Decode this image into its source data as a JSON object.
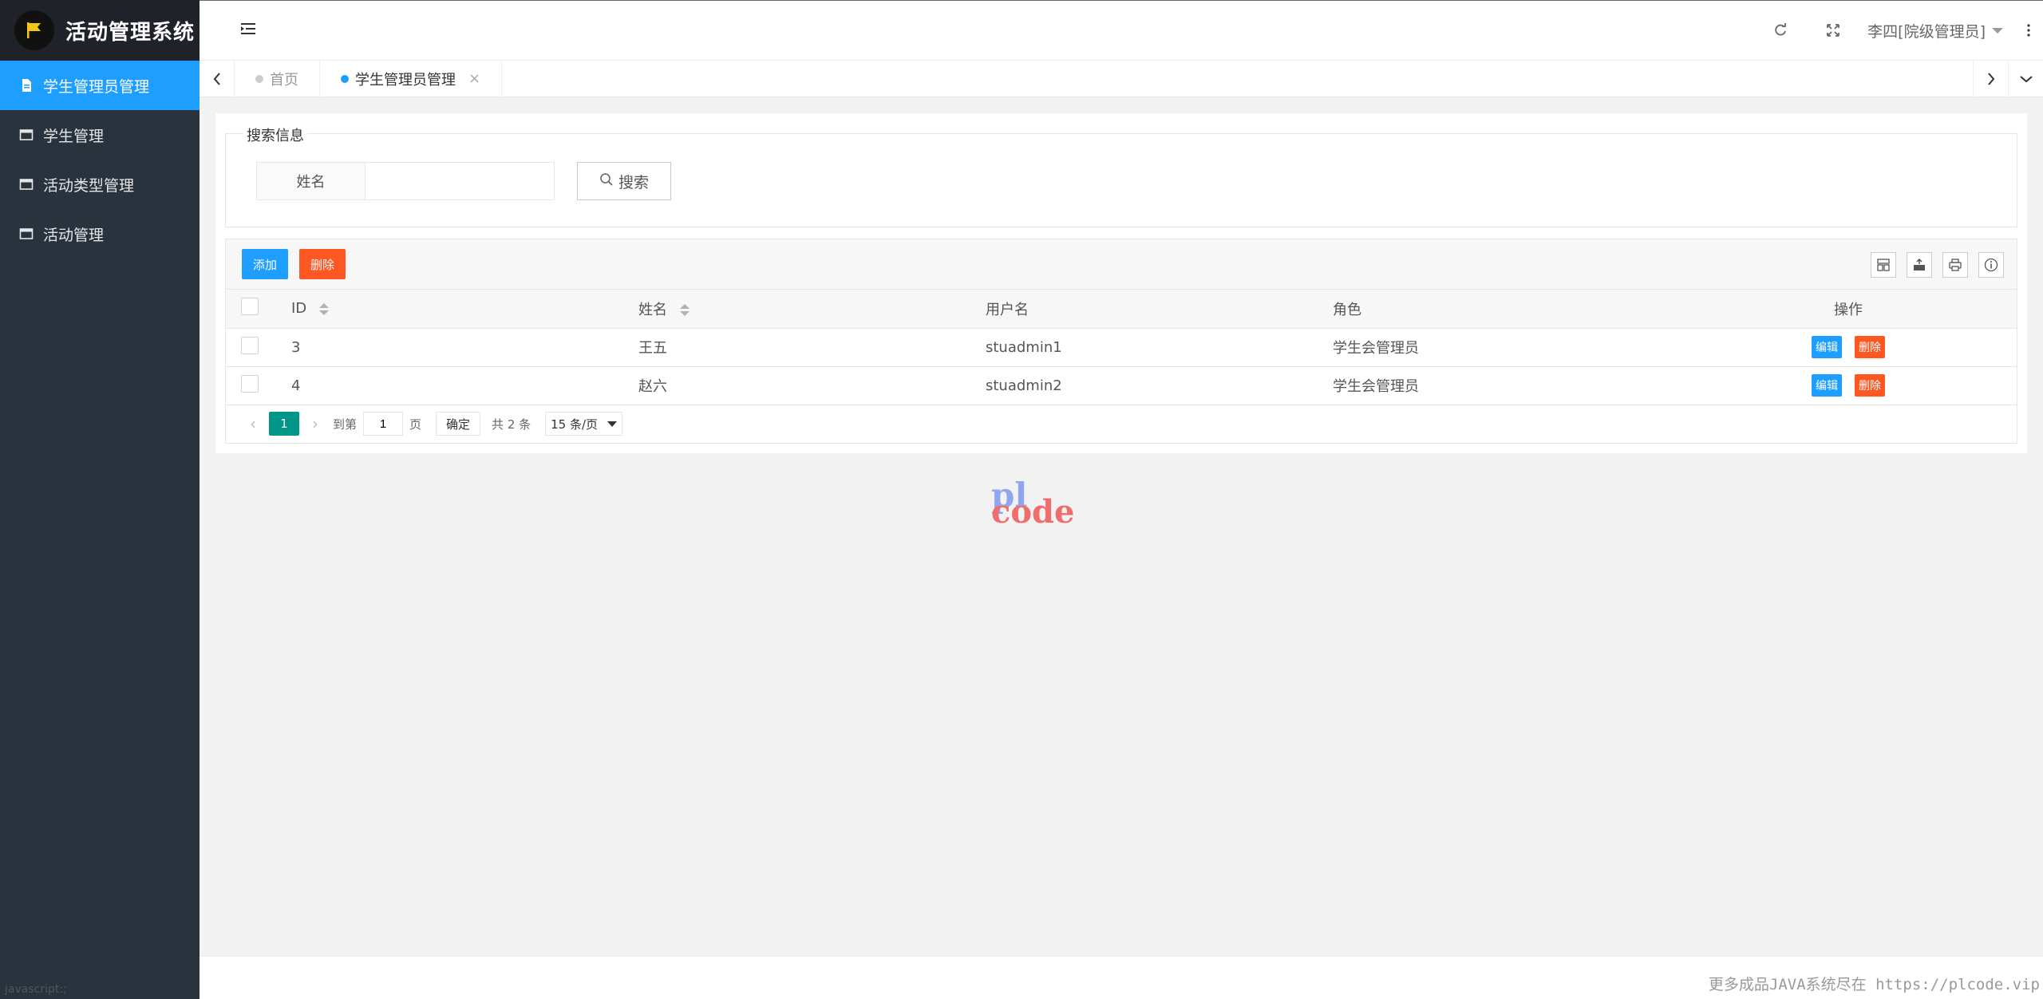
{
  "app": {
    "title": "活动管理系统"
  },
  "sidebar": {
    "items": [
      {
        "label": "学生管理员管理",
        "active": true,
        "icon": "document-icon"
      },
      {
        "label": "学生管理",
        "active": false,
        "icon": "window-icon"
      },
      {
        "label": "活动类型管理",
        "active": false,
        "icon": "window-icon"
      },
      {
        "label": "活动管理",
        "active": false,
        "icon": "window-icon"
      }
    ],
    "footer": "javascript:;"
  },
  "header": {
    "user": "李四[院级管理员]"
  },
  "tabs": [
    {
      "label": "首页",
      "active": false
    },
    {
      "label": "学生管理员管理",
      "active": true,
      "close": "×"
    }
  ],
  "search": {
    "legend": "搜索信息",
    "field_label": "姓名",
    "field_value": "",
    "button": "搜索"
  },
  "toolbar": {
    "add": "添加",
    "delete": "删除"
  },
  "table": {
    "headers": {
      "id": "ID",
      "name": "姓名",
      "username": "用户名",
      "role": "角色",
      "actions": "操作"
    },
    "rows": [
      {
        "id": "3",
        "name": "王五",
        "username": "stuadmin1",
        "role": "学生会管理员",
        "edit": "编辑",
        "delete": "删除"
      },
      {
        "id": "4",
        "name": "赵六",
        "username": "stuadmin2",
        "role": "学生会管理员",
        "edit": "编辑",
        "delete": "删除"
      }
    ]
  },
  "pager": {
    "current": "1",
    "goto_label": "到第",
    "goto_value": "1",
    "page_unit": "页",
    "confirm": "确定",
    "total": "共 2 条",
    "per_page": "15 条/页"
  },
  "watermark": {
    "pl": "pl",
    "code": "code"
  },
  "footer": {
    "text": "更多成品JAVA系统尽在 https://plcode.vip"
  },
  "colors": {
    "primary": "#1e9fff",
    "danger": "#ff5722",
    "pager_active": "#009688",
    "sidebar": "#28333e"
  }
}
